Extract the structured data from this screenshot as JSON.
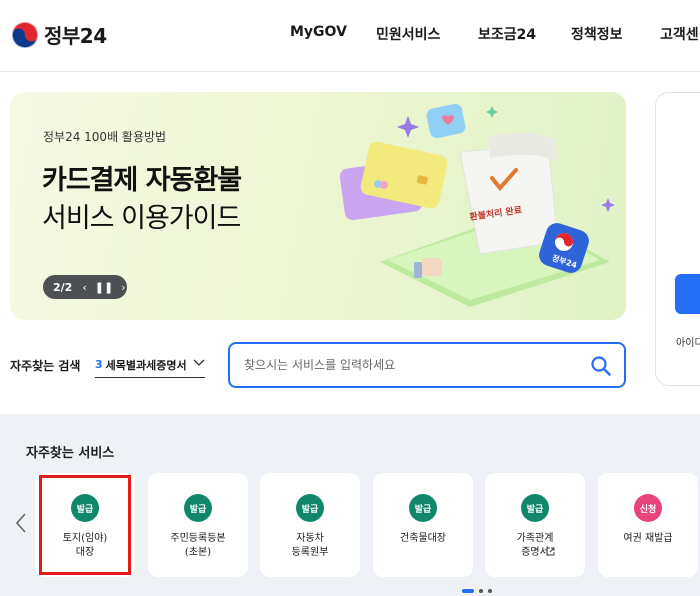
{
  "header": {
    "logo_text": "정부24",
    "nav": [
      "MyGOV",
      "민원서비스",
      "보조금24",
      "정책정보",
      "고객센"
    ]
  },
  "banner": {
    "subtitle": "정부24 100배 활용방법",
    "title_line1": "카드결제 자동환불",
    "title_line2": "서비스 이용가이드",
    "pager": "2/2",
    "receipt_text": "환불처리 완료",
    "badge_text": "정부24"
  },
  "side": {
    "text": "아이디"
  },
  "search": {
    "label": "자주찾는 검색",
    "selected_rank": "3",
    "selected_value": "세목별과세증명서",
    "placeholder": "찾으시는 서비스를 입력하세요"
  },
  "services": {
    "title": "자주찾는 서비스",
    "items": [
      {
        "badge": "발급",
        "label": "토지(임야)\n대장",
        "color": "#10876b"
      },
      {
        "badge": "발급",
        "label": "주민등록등본\n(초본)",
        "color": "#10876b"
      },
      {
        "badge": "발급",
        "label": "자동차\n등록원부",
        "color": "#10876b"
      },
      {
        "badge": "발급",
        "label": "건축물대장",
        "color": "#10876b"
      },
      {
        "badge": "발급",
        "label": "가족관계\n증명서",
        "color": "#10876b"
      },
      {
        "badge": "신청",
        "label": "여권 재발급",
        "color": "#e8437a"
      }
    ]
  },
  "colors": {
    "accent": "#256ef4",
    "issue": "#10876b",
    "apply": "#e8437a",
    "highlight": "#e31b1b"
  }
}
